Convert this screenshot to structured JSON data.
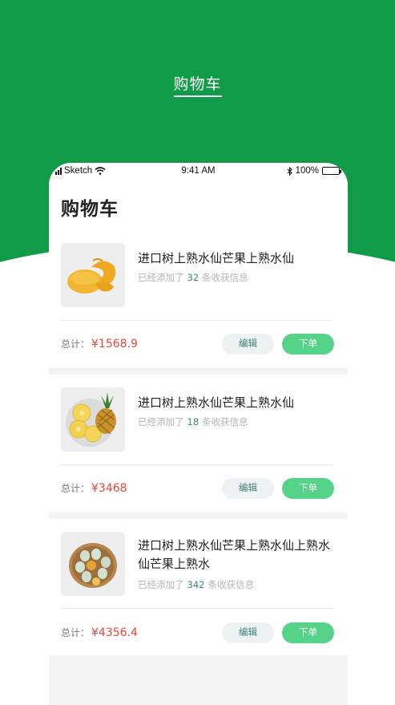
{
  "hero": {
    "title": "购物车"
  },
  "status_bar": {
    "carrier": "Sketch",
    "time": "9:41 AM",
    "battery": "100%"
  },
  "page": {
    "title": "购物车"
  },
  "common": {
    "added_prefix": "已经添加了",
    "added_suffix": "条收获信息",
    "total_label": "总计：",
    "edit_label": "编辑",
    "order_label": "下单"
  },
  "cart_items": [
    {
      "name": "进口树上熟水仙芒果上熟水仙",
      "count": "32",
      "total": "¥1568.9",
      "image": "mango"
    },
    {
      "name": "进口树上熟水仙芒果上熟水仙",
      "count": "18",
      "total": "¥3468",
      "image": "pineapple"
    },
    {
      "name": "进口树上熟水仙芒果上熟水仙上熟水仙芒果上熟水",
      "count": "342",
      "total": "¥4356.4",
      "image": "eggs"
    }
  ],
  "colors": {
    "brand_green": "#0f9b47",
    "button_green": "#54d389",
    "price_red": "#e8463c",
    "count_teal": "#3a8a7e"
  }
}
